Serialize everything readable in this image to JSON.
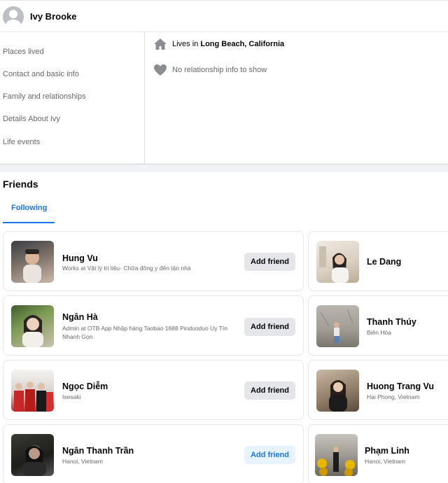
{
  "header": {
    "name": "Ivy Brooke",
    "avatar_icon": "default-avatar-icon"
  },
  "sidebar": {
    "items": [
      {
        "label": "Places lived"
      },
      {
        "label": "Contact and basic info"
      },
      {
        "label": "Family and relationships"
      },
      {
        "label": "Details About Ivy"
      },
      {
        "label": "Life events"
      }
    ]
  },
  "about": {
    "lives_prefix": "Lives in ",
    "lives_place": "Long Beach, California",
    "home_icon": "home-icon",
    "relationship": "No relationship info to show",
    "heart_icon": "heart-icon"
  },
  "friends": {
    "title": "Friends",
    "tab_following": "Following",
    "add_label": "Add friend",
    "left": [
      {
        "name": "Hung Vu",
        "sub": "Works at Vật lý trị liệu- Chữa đông y đến tận nhà"
      },
      {
        "name": "Ngân Hà",
        "sub": "Admin at OTB App Nhập hàng Taobao 1688 Pinduoduo Uy Tín Nhanh Gọn"
      },
      {
        "name": "Ngọc Diễm",
        "sub": "Isesaki"
      },
      {
        "name": "Ngân Thanh Trần",
        "sub": "Hanoi, Vietnam"
      }
    ],
    "right": [
      {
        "name": "Le Dang",
        "sub": ""
      },
      {
        "name": "Thanh Thúy",
        "sub": "Biên Hòa"
      },
      {
        "name": "Huong Trang Vu",
        "sub": "Hai Phong, Vietnam"
      },
      {
        "name": "Phạm Linh",
        "sub": "Hanoi, Vietnam"
      }
    ]
  },
  "colors": {
    "accent": "#1877f2",
    "muted_text": "#65676b",
    "button_gray": "#e4e6eb",
    "page_bg": "#f0f2f5"
  }
}
